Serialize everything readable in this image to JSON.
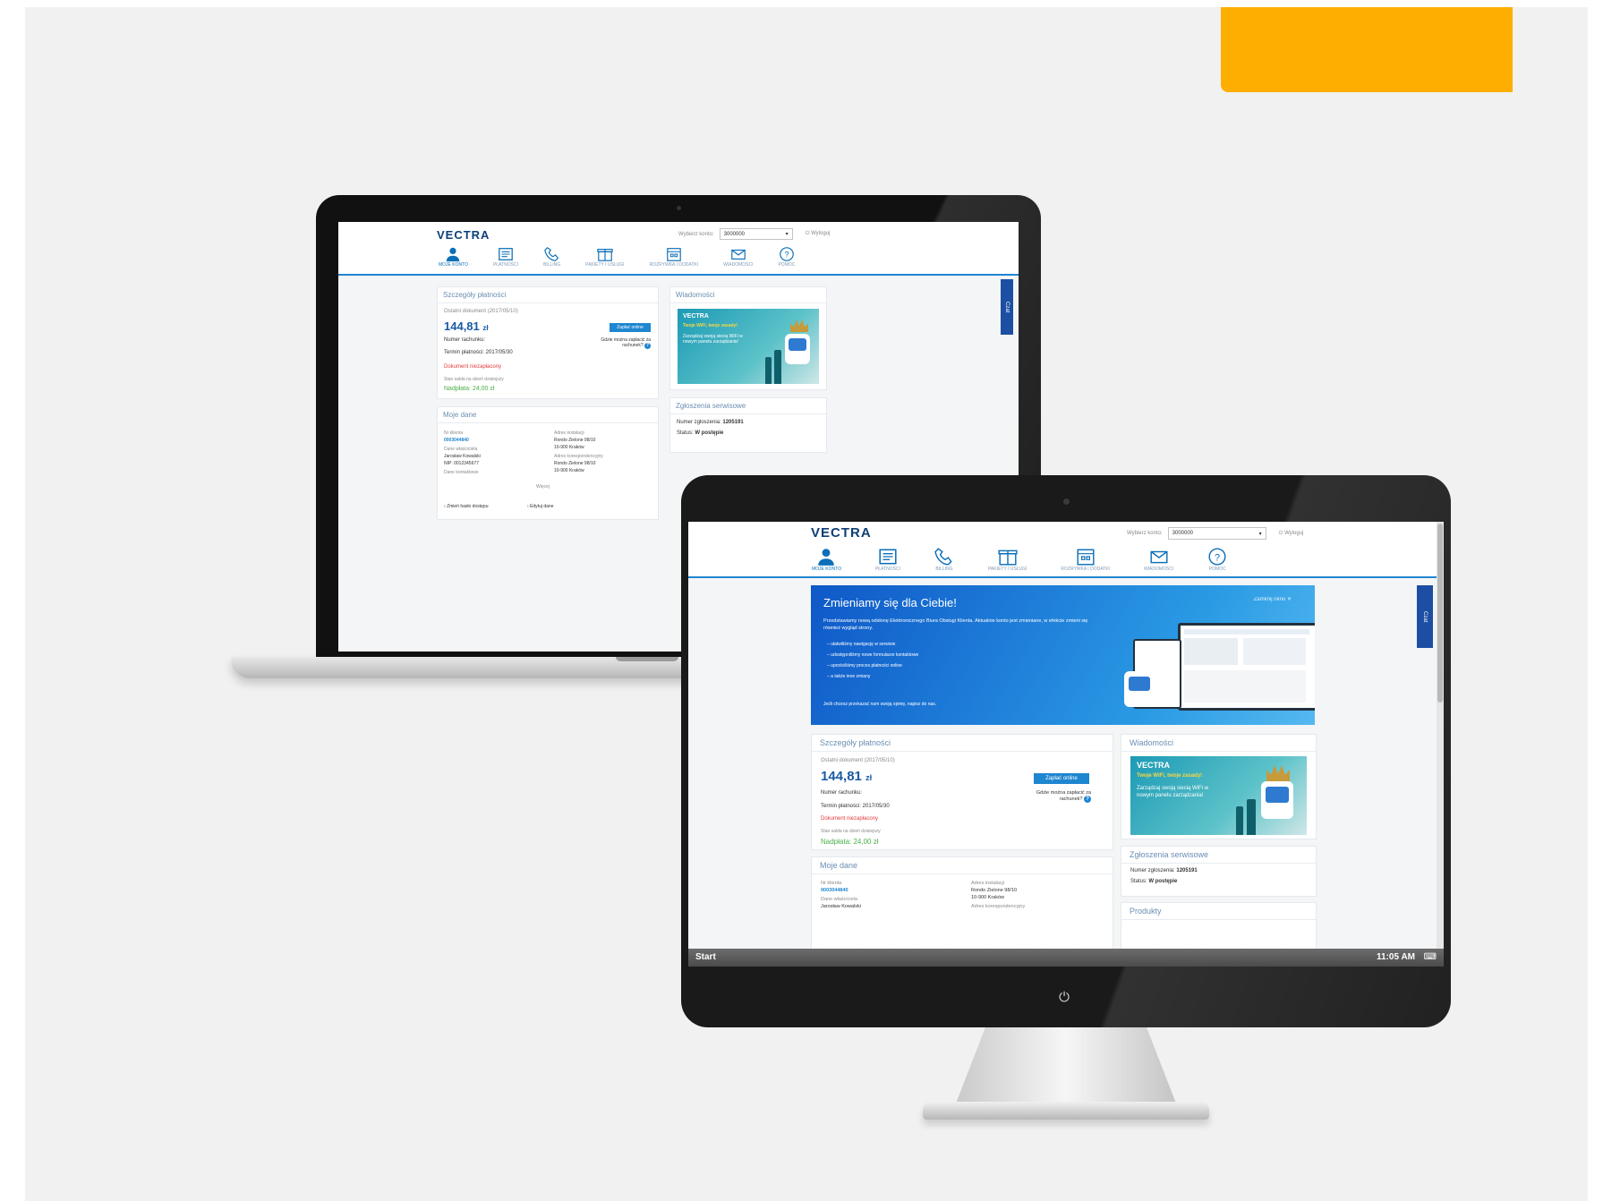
{
  "brand": {
    "logo": "VECTRA"
  },
  "header": {
    "account_label": "Wybierz konto:",
    "account_value": "3000000",
    "logout_label": "Wyloguj",
    "logout_icon": "logout-icon"
  },
  "nav": [
    {
      "label": "MOJE KONTO",
      "icon": "user-icon"
    },
    {
      "label": "PŁATNOŚCI",
      "icon": "invoice-icon"
    },
    {
      "label": "BILLING",
      "icon": "phone-icon"
    },
    {
      "label": "PAKIETY I USŁUGI",
      "icon": "packages-icon"
    },
    {
      "label": "ROZRYWKA I DODATKI",
      "icon": "calendar-icon"
    },
    {
      "label": "WIADOMOŚCI",
      "icon": "mail-icon"
    },
    {
      "label": "POMOC",
      "icon": "help-icon"
    }
  ],
  "side_tab": "Czat",
  "banner": {
    "title": "Zmieniamy się dla Ciebie!",
    "close_label": "Zamknij okno",
    "intro": "Przedstawiamy nową odsłonę Elektronicznego Biura Obsługi Klienta. Aktualnie konto jest zmieniane, w efekcie zmieni się również wygląd strony.",
    "bullets": [
      "ułatwiliśmy nawigację w serwisie",
      "udostępniliśmy nowe formularze kontaktowe",
      "uprościliśmy proces płatności online",
      "a także inne zmiany"
    ],
    "footer": "Jeśli chcesz przekazać nam swoją opinię, napisz do nas."
  },
  "payments": {
    "title": "Szczegóły płatności",
    "doc_label": "Ostatni dokument (2017/05/10)",
    "amount_whole": "144,81",
    "amount_unit": "zł",
    "pay_button": "Zapłać online",
    "account_label": "Numer rachunku:",
    "due_label": "Termin płatności: 2017/05/30",
    "status": "Dokument niezapłacony",
    "balance_label": "Stan salda na dzień dzisiejszy",
    "overpaid": "Nadpłata: 24,00 zł",
    "help_text": "Gdzie można zapłacić za rachunek?"
  },
  "messages": {
    "title": "Wiadomości",
    "promo_brand": "VECTRA",
    "promo_headline": "Twoje WiFi, twoje zasady!",
    "promo_text": "Zarządzaj swoją siecią WiFi w nowym panelu zarządzania!"
  },
  "service": {
    "title": "Zgłoszenia serwisowe",
    "number_label": "Numer zgłoszenia:",
    "number": "1205191",
    "status_label": "Status:",
    "status": "W postępie"
  },
  "products": {
    "title": "Produkty"
  },
  "my_data": {
    "title": "Moje dane",
    "client_no_label": "Nr klienta",
    "client_no": "0003044840",
    "name_label": "Dane właściciela",
    "name": "Jarosław Kowalski",
    "nip": "NIP: 0012345677",
    "contact_label": "Dane kontaktowe",
    "address_label": "Adres instalacji",
    "address": "Rondo Zielone 98/10",
    "city": "10-900 Kraków",
    "billing_label": "Adres korespondencyjny",
    "billing_address": "Rondo Zielone 98/10",
    "billing_city": "10-900 Kraków",
    "more": "Więcej",
    "edit_link": "Zmień hasło dostępu",
    "data_link": "Edytuj dane"
  },
  "taskbar": {
    "start": "Start",
    "time": "11:05 AM"
  },
  "colors": {
    "accent": "#fdae00",
    "brand_blue": "#1f86d0",
    "navy": "#0d3f77",
    "status_red": "#e23b3b",
    "status_green": "#4bb04b"
  }
}
